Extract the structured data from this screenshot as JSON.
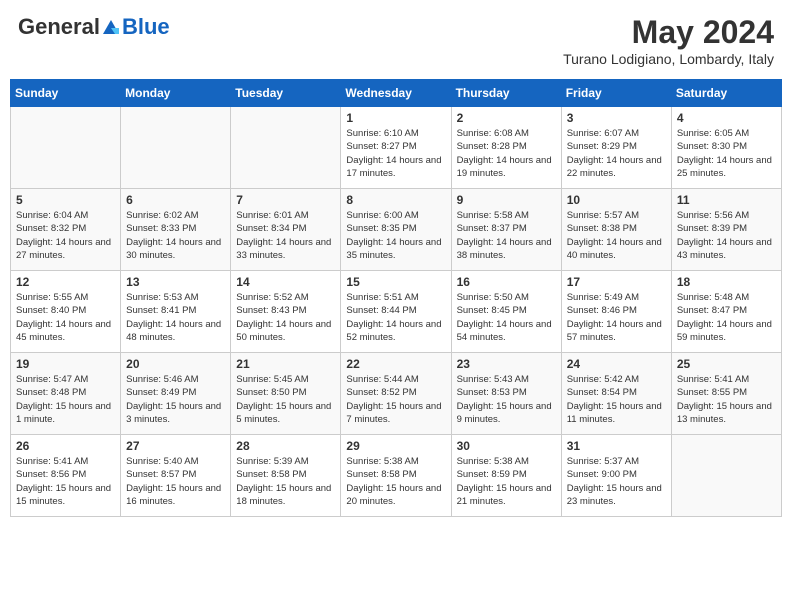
{
  "header": {
    "logo_general": "General",
    "logo_blue": "Blue",
    "month": "May 2024",
    "location": "Turano Lodigiano, Lombardy, Italy"
  },
  "days_of_week": [
    "Sunday",
    "Monday",
    "Tuesday",
    "Wednesday",
    "Thursday",
    "Friday",
    "Saturday"
  ],
  "weeks": [
    [
      {
        "day": "",
        "info": ""
      },
      {
        "day": "",
        "info": ""
      },
      {
        "day": "",
        "info": ""
      },
      {
        "day": "1",
        "info": "Sunrise: 6:10 AM\nSunset: 8:27 PM\nDaylight: 14 hours and 17 minutes."
      },
      {
        "day": "2",
        "info": "Sunrise: 6:08 AM\nSunset: 8:28 PM\nDaylight: 14 hours and 19 minutes."
      },
      {
        "day": "3",
        "info": "Sunrise: 6:07 AM\nSunset: 8:29 PM\nDaylight: 14 hours and 22 minutes."
      },
      {
        "day": "4",
        "info": "Sunrise: 6:05 AM\nSunset: 8:30 PM\nDaylight: 14 hours and 25 minutes."
      }
    ],
    [
      {
        "day": "5",
        "info": "Sunrise: 6:04 AM\nSunset: 8:32 PM\nDaylight: 14 hours and 27 minutes."
      },
      {
        "day": "6",
        "info": "Sunrise: 6:02 AM\nSunset: 8:33 PM\nDaylight: 14 hours and 30 minutes."
      },
      {
        "day": "7",
        "info": "Sunrise: 6:01 AM\nSunset: 8:34 PM\nDaylight: 14 hours and 33 minutes."
      },
      {
        "day": "8",
        "info": "Sunrise: 6:00 AM\nSunset: 8:35 PM\nDaylight: 14 hours and 35 minutes."
      },
      {
        "day": "9",
        "info": "Sunrise: 5:58 AM\nSunset: 8:37 PM\nDaylight: 14 hours and 38 minutes."
      },
      {
        "day": "10",
        "info": "Sunrise: 5:57 AM\nSunset: 8:38 PM\nDaylight: 14 hours and 40 minutes."
      },
      {
        "day": "11",
        "info": "Sunrise: 5:56 AM\nSunset: 8:39 PM\nDaylight: 14 hours and 43 minutes."
      }
    ],
    [
      {
        "day": "12",
        "info": "Sunrise: 5:55 AM\nSunset: 8:40 PM\nDaylight: 14 hours and 45 minutes."
      },
      {
        "day": "13",
        "info": "Sunrise: 5:53 AM\nSunset: 8:41 PM\nDaylight: 14 hours and 48 minutes."
      },
      {
        "day": "14",
        "info": "Sunrise: 5:52 AM\nSunset: 8:43 PM\nDaylight: 14 hours and 50 minutes."
      },
      {
        "day": "15",
        "info": "Sunrise: 5:51 AM\nSunset: 8:44 PM\nDaylight: 14 hours and 52 minutes."
      },
      {
        "day": "16",
        "info": "Sunrise: 5:50 AM\nSunset: 8:45 PM\nDaylight: 14 hours and 54 minutes."
      },
      {
        "day": "17",
        "info": "Sunrise: 5:49 AM\nSunset: 8:46 PM\nDaylight: 14 hours and 57 minutes."
      },
      {
        "day": "18",
        "info": "Sunrise: 5:48 AM\nSunset: 8:47 PM\nDaylight: 14 hours and 59 minutes."
      }
    ],
    [
      {
        "day": "19",
        "info": "Sunrise: 5:47 AM\nSunset: 8:48 PM\nDaylight: 15 hours and 1 minute."
      },
      {
        "day": "20",
        "info": "Sunrise: 5:46 AM\nSunset: 8:49 PM\nDaylight: 15 hours and 3 minutes."
      },
      {
        "day": "21",
        "info": "Sunrise: 5:45 AM\nSunset: 8:50 PM\nDaylight: 15 hours and 5 minutes."
      },
      {
        "day": "22",
        "info": "Sunrise: 5:44 AM\nSunset: 8:52 PM\nDaylight: 15 hours and 7 minutes."
      },
      {
        "day": "23",
        "info": "Sunrise: 5:43 AM\nSunset: 8:53 PM\nDaylight: 15 hours and 9 minutes."
      },
      {
        "day": "24",
        "info": "Sunrise: 5:42 AM\nSunset: 8:54 PM\nDaylight: 15 hours and 11 minutes."
      },
      {
        "day": "25",
        "info": "Sunrise: 5:41 AM\nSunset: 8:55 PM\nDaylight: 15 hours and 13 minutes."
      }
    ],
    [
      {
        "day": "26",
        "info": "Sunrise: 5:41 AM\nSunset: 8:56 PM\nDaylight: 15 hours and 15 minutes."
      },
      {
        "day": "27",
        "info": "Sunrise: 5:40 AM\nSunset: 8:57 PM\nDaylight: 15 hours and 16 minutes."
      },
      {
        "day": "28",
        "info": "Sunrise: 5:39 AM\nSunset: 8:58 PM\nDaylight: 15 hours and 18 minutes."
      },
      {
        "day": "29",
        "info": "Sunrise: 5:38 AM\nSunset: 8:58 PM\nDaylight: 15 hours and 20 minutes."
      },
      {
        "day": "30",
        "info": "Sunrise: 5:38 AM\nSunset: 8:59 PM\nDaylight: 15 hours and 21 minutes."
      },
      {
        "day": "31",
        "info": "Sunrise: 5:37 AM\nSunset: 9:00 PM\nDaylight: 15 hours and 23 minutes."
      },
      {
        "day": "",
        "info": ""
      }
    ]
  ]
}
